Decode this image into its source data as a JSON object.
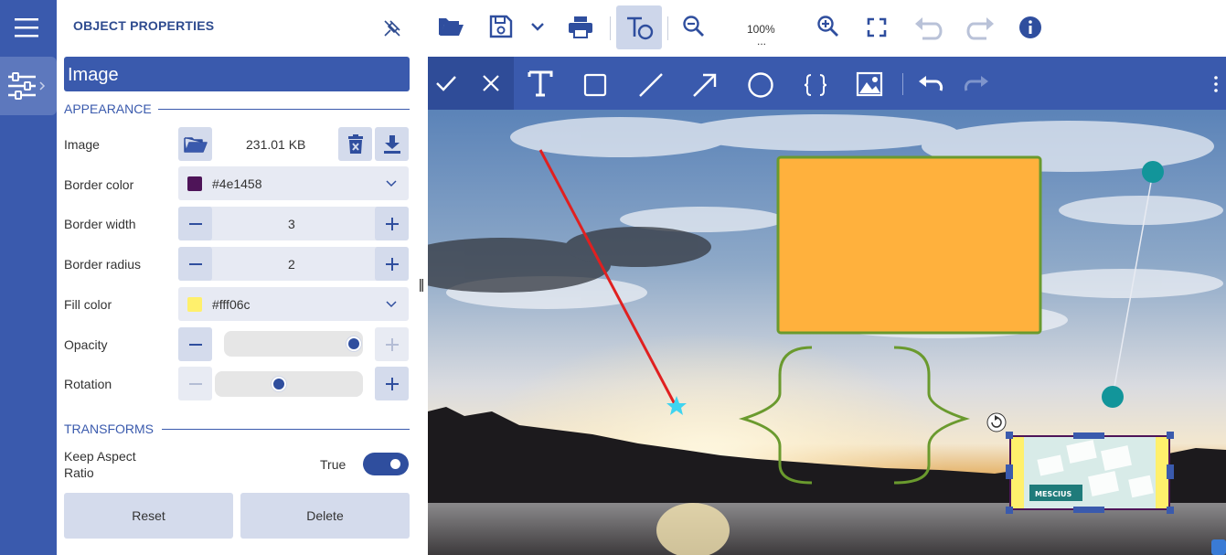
{
  "panel": {
    "title": "OBJECT PROPERTIES",
    "object_name": "Image",
    "appearance_label": "APPEARANCE",
    "transforms_label": "TRANSFORMS",
    "image": {
      "label": "Image",
      "size": "231.01 KB"
    },
    "border_color": {
      "label": "Border color",
      "value": "#4e1458",
      "swatch": "#4e1458"
    },
    "border_width": {
      "label": "Border width",
      "value": "3"
    },
    "border_radius": {
      "label": "Border radius",
      "value": "2"
    },
    "fill_color": {
      "label": "Fill color",
      "value": "#fff06c",
      "swatch": "#fff06c"
    },
    "opacity": {
      "label": "Opacity",
      "level": 1.0
    },
    "rotation": {
      "label": "Rotation",
      "level": 0.0
    },
    "keep_aspect": {
      "label": "Keep Aspect Ratio",
      "value": "True",
      "on": true
    },
    "reset_label": "Reset",
    "delete_label": "Delete"
  },
  "toolbar": {
    "zoom": "100%",
    "zoom_more": "..."
  },
  "canvas": {
    "mini_brand": "MESCIUS"
  },
  "colors": {
    "primary": "#3a5aad",
    "primary_dark": "#2f4c98",
    "rect_fill": "#ffb13d",
    "rect_border": "#6a9a2e",
    "brace": "#6a9a2e",
    "line_red": "#e02020",
    "teal_dot": "#12959a",
    "star": "#3fd4f0"
  }
}
